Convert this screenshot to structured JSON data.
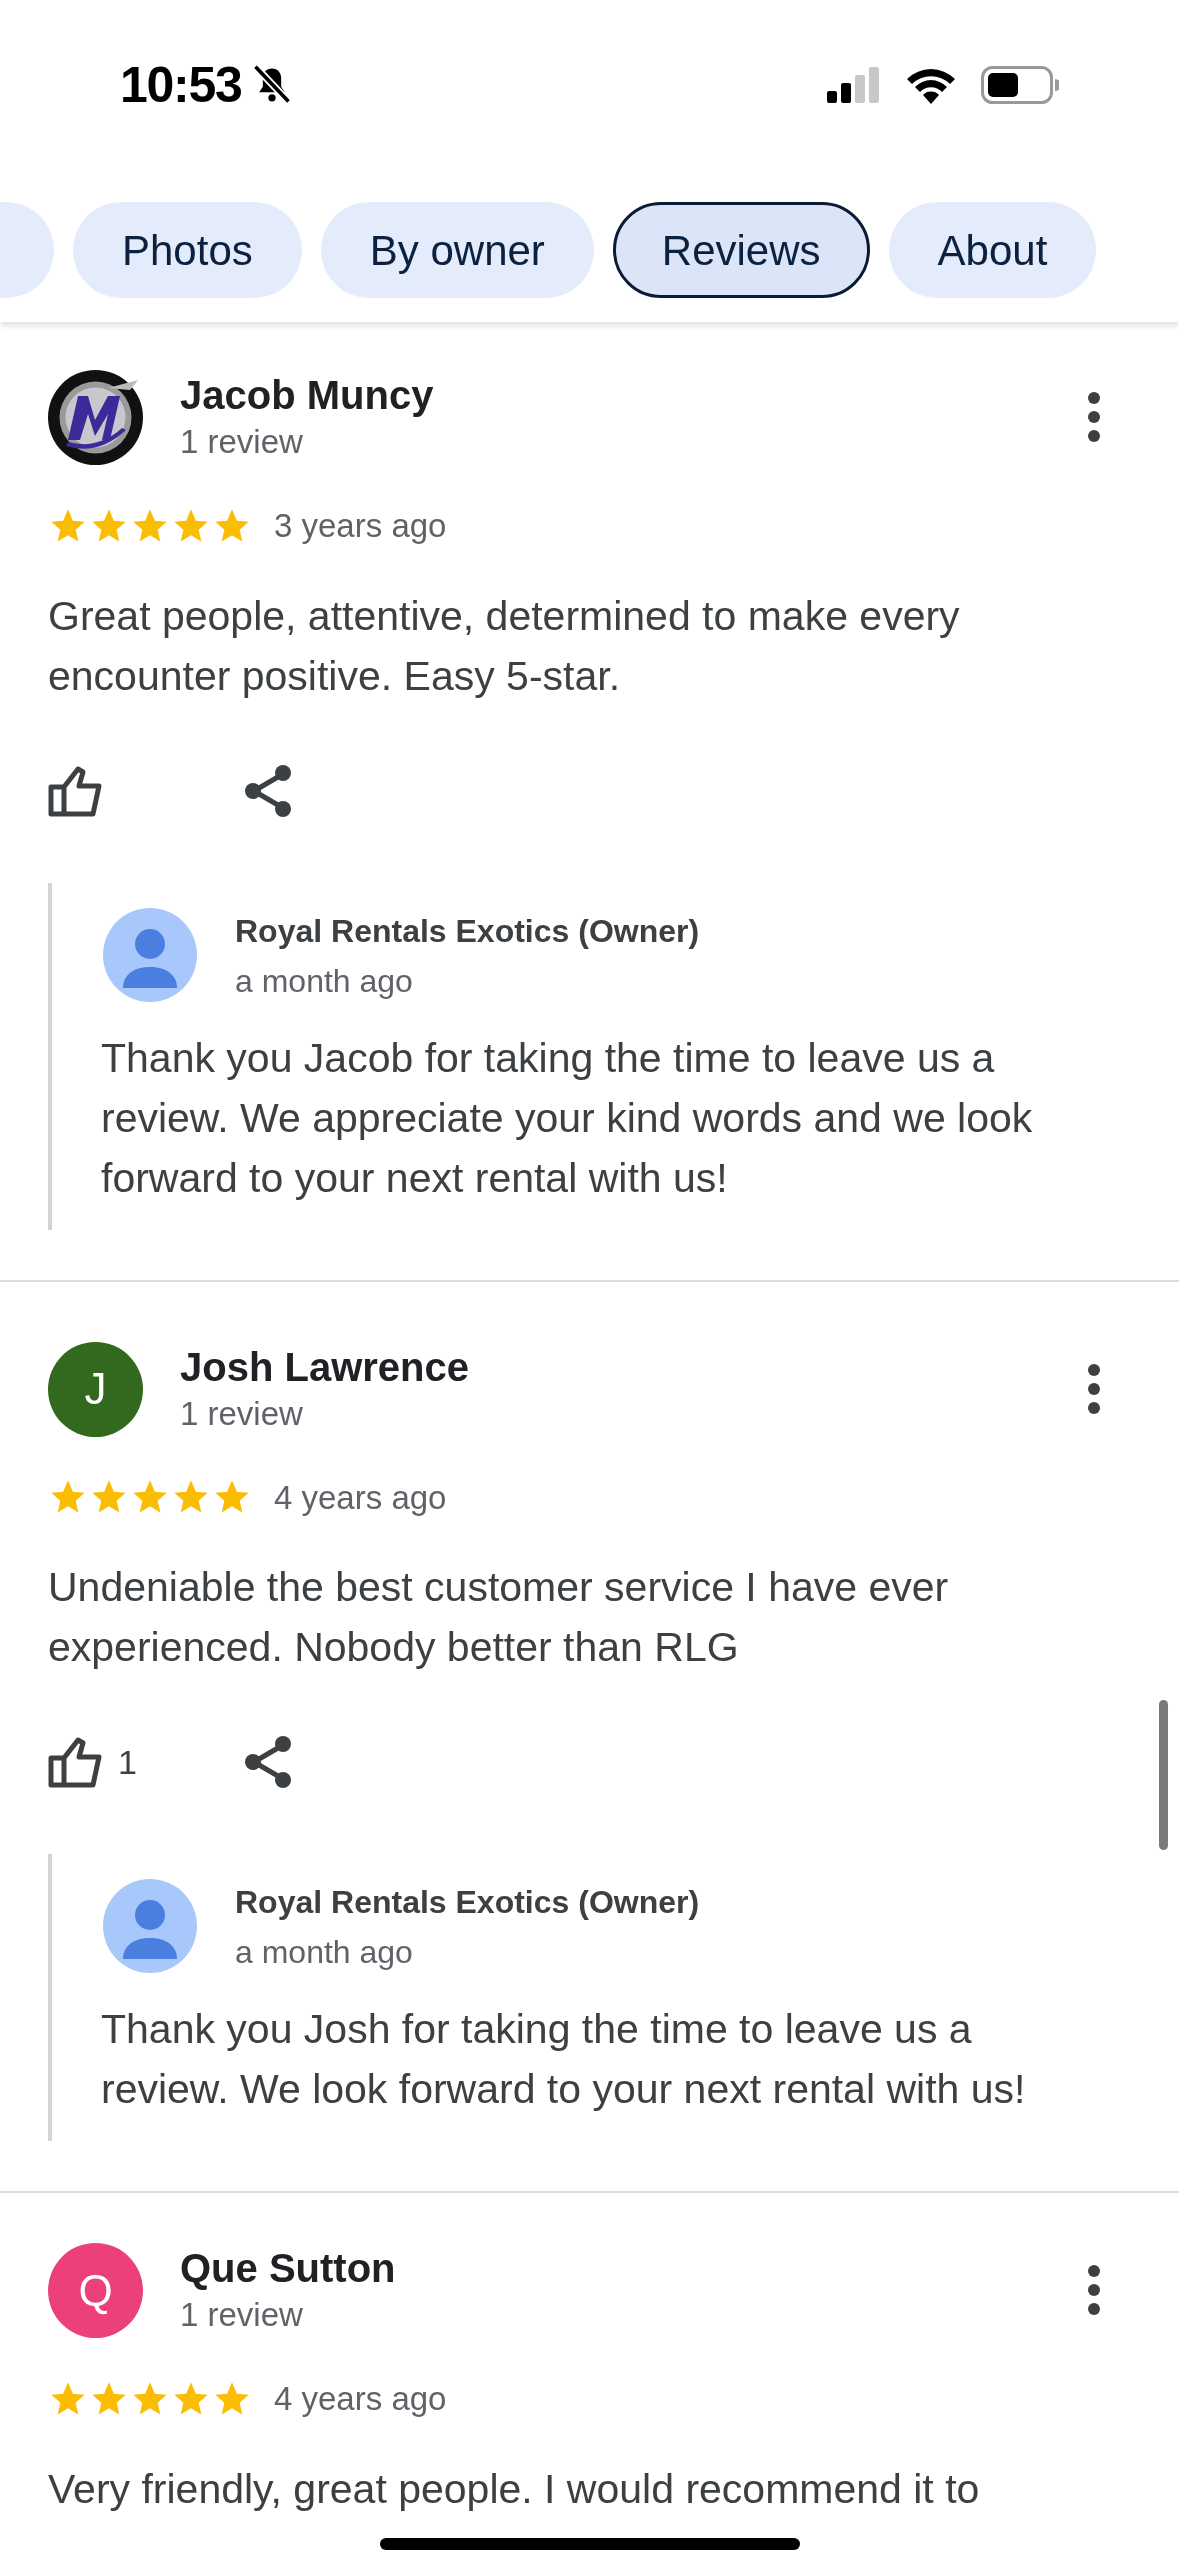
{
  "status_bar": {
    "time": "10:53",
    "silent": true
  },
  "tabs": [
    {
      "label": "Photos",
      "selected": false
    },
    {
      "label": "By owner",
      "selected": false
    },
    {
      "label": "Reviews",
      "selected": true
    },
    {
      "label": "About",
      "selected": false
    }
  ],
  "reviews": [
    {
      "author": "Jacob Muncy",
      "review_count": "1 review",
      "stars": 5,
      "time": "3 years ago",
      "text": "Great people, attentive, determined to make every encounter positive. Easy 5-star.",
      "reply": {
        "author": "Royal Rentals Exotics (Owner)",
        "time": "a month ago",
        "text": "Thank you Jacob for taking the time to leave us a review. We appreciate your kind words and we look forward to your next rental with us!"
      }
    },
    {
      "author": "Josh Lawrence",
      "review_count": "1 review",
      "avatar": {
        "kind": "initial",
        "initial": "J",
        "color": "#33691e"
      },
      "stars": 5,
      "time": "4 years ago",
      "text": "Undeniable the best customer service I have ever experienced. Nobody better than RLG",
      "likes": "1",
      "reply": {
        "author": "Royal Rentals Exotics (Owner)",
        "time": "a month ago",
        "text": "Thank you Josh for taking the time to leave us a review. We look forward to your next rental with us!"
      }
    },
    {
      "author": "Que Sutton",
      "review_count": "1 review",
      "avatar": {
        "kind": "initial",
        "initial": "Q",
        "color": "#ec407a"
      },
      "stars": 5,
      "time": "4 years ago",
      "text": "Very friendly, great people. I would recommend it to"
    }
  ]
}
